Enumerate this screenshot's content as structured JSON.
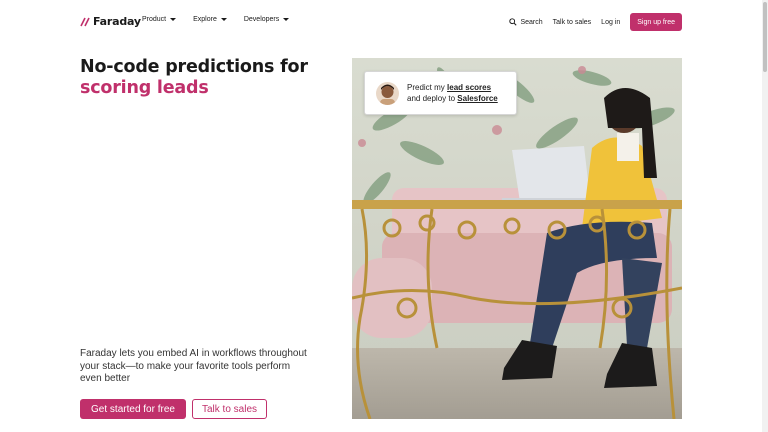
{
  "nav": {
    "brand": "Faraday",
    "menu": [
      {
        "label": "Product"
      },
      {
        "label": "Explore"
      },
      {
        "label": "Developers"
      }
    ],
    "search_label": "Search",
    "talk_label": "Talk to sales",
    "login_label": "Log in",
    "signup_label": "Sign up free"
  },
  "hero": {
    "title_line1": "No-code predictions for",
    "title_line2": "scoring leads",
    "description": "Faraday lets you embed AI in workflows throughout your stack—to make your favorite tools perform even better",
    "primary_cta": "Get started for free",
    "secondary_cta": "Talk to sales"
  },
  "callout": {
    "prefix": "Predict my",
    "link1": "lead scores",
    "middle": "and deploy to",
    "link2": "Salesforce"
  },
  "colors": {
    "accent": "#c0306b",
    "text": "#1a1a1a"
  }
}
